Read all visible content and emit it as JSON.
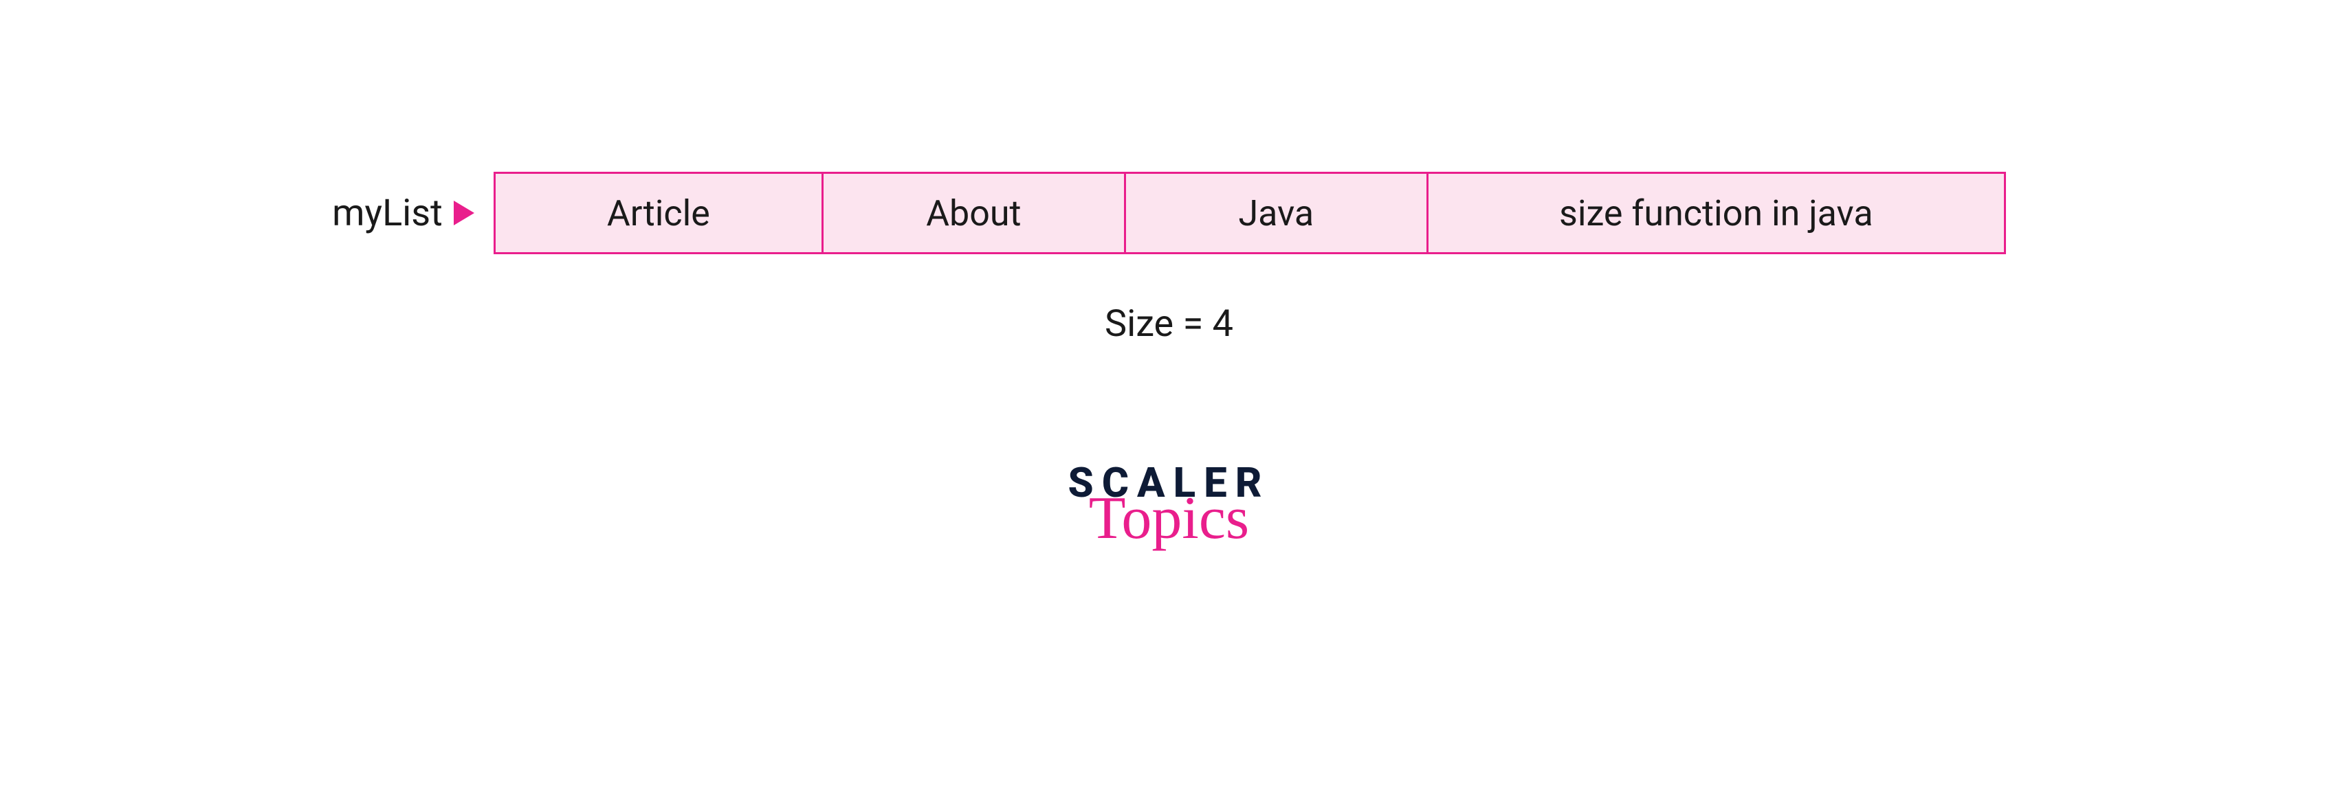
{
  "list": {
    "label": "myList",
    "items": [
      "Article",
      "About",
      "Java",
      "size function in java"
    ]
  },
  "size_text": "Size = 4",
  "logo": {
    "line1": "SCALER",
    "line2": "Topics"
  }
}
